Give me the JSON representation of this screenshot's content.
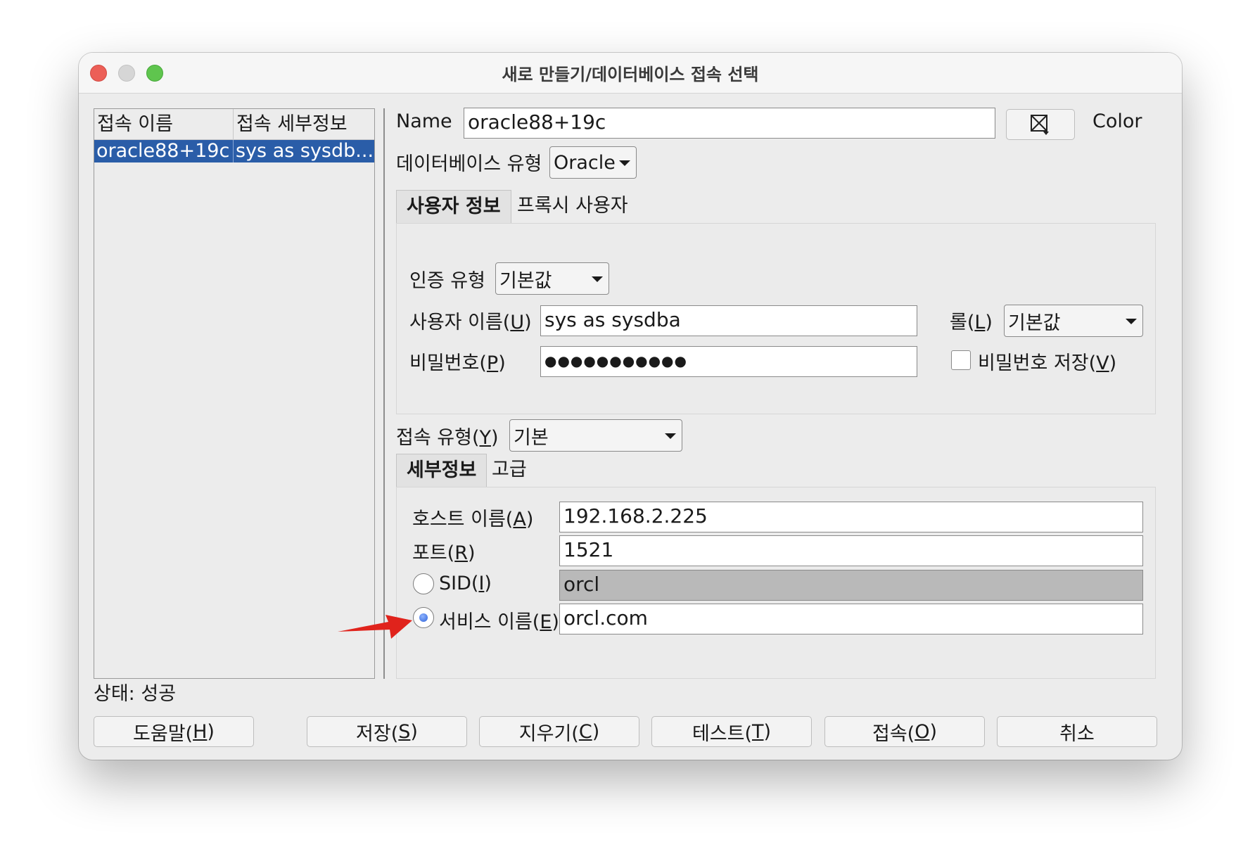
{
  "window": {
    "title": "새로 만들기/데이터베이스 접속 선택"
  },
  "connection_list": {
    "columns": [
      "접속 이름",
      "접속 세부정보"
    ],
    "rows": [
      {
        "name": "oracle88+19c",
        "details": "sys as sysdb..."
      }
    ]
  },
  "form": {
    "name_label": "Name",
    "name_value": "oracle88+19c",
    "color_label": "Color",
    "db_type_label": "데이터베이스 유형",
    "db_type_value": "Oracle",
    "tabs": [
      "사용자 정보",
      "프록시 사용자"
    ],
    "auth_type_label": "인증 유형",
    "auth_type_value": "기본값",
    "username_label": "사용자 이름(",
    "username_mnemonic": "U",
    "username_value": "sys as sysdba",
    "role_label": "롤(",
    "role_mnemonic": "L",
    "role_value": "기본값",
    "password_label": "비밀번호(",
    "password_mnemonic": "P",
    "password_value": "●●●●●●●●●●●",
    "save_password_label": "비밀번호 저장(",
    "save_password_mnemonic": "V",
    "conn_type_label": "접속 유형(",
    "conn_type_mnemonic": "Y",
    "conn_type_value": "기본",
    "detail_tabs": [
      "세부정보",
      "고급"
    ],
    "host_label": "호스트 이름(",
    "host_mnemonic": "A",
    "host_value": "192.168.2.225",
    "port_label": "포트(",
    "port_mnemonic": "R",
    "port_value": "1521",
    "sid_label": "SID(",
    "sid_mnemonic": "I",
    "sid_value": "orcl",
    "service_label": "서비스 이름(",
    "service_mnemonic": "E",
    "service_value": "orcl.com",
    "close_paren": ")"
  },
  "status": {
    "text": "상태: 성공"
  },
  "buttons": {
    "help": {
      "label": "도움말(",
      "mnemonic": "H"
    },
    "save": {
      "label": "저장(",
      "mnemonic": "S"
    },
    "clear": {
      "label": "지우기(",
      "mnemonic": "C"
    },
    "test": {
      "label": "테스트(",
      "mnemonic": "T"
    },
    "connect": {
      "label": "접속(",
      "mnemonic": "O"
    },
    "cancel": {
      "label": "취소"
    }
  },
  "colors": {
    "selection": "#2a5da8",
    "annotation_arrow": "#e0231c",
    "close_light": "#ec5f57",
    "zoom_light": "#5fc54e"
  }
}
